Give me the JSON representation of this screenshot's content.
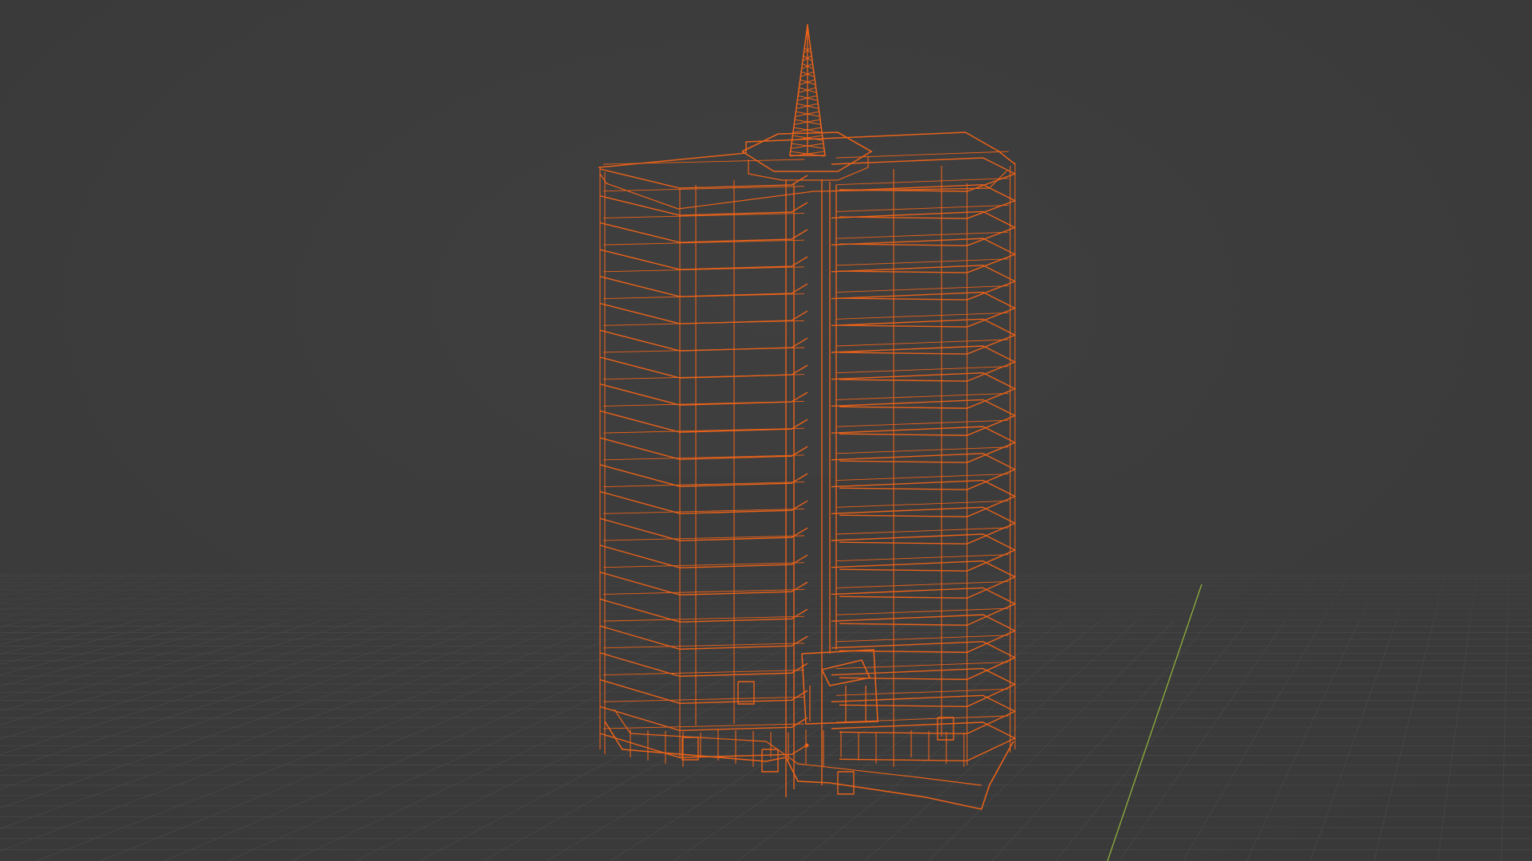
{
  "viewport": {
    "mode": "wireframe",
    "background_color": "#3d3d3d",
    "grid_color": "#474747",
    "y_axis_color": "#8db13a",
    "selection_color": "#e8621a",
    "selected_object": "skyscraper-with-antenna",
    "floors": 21
  }
}
